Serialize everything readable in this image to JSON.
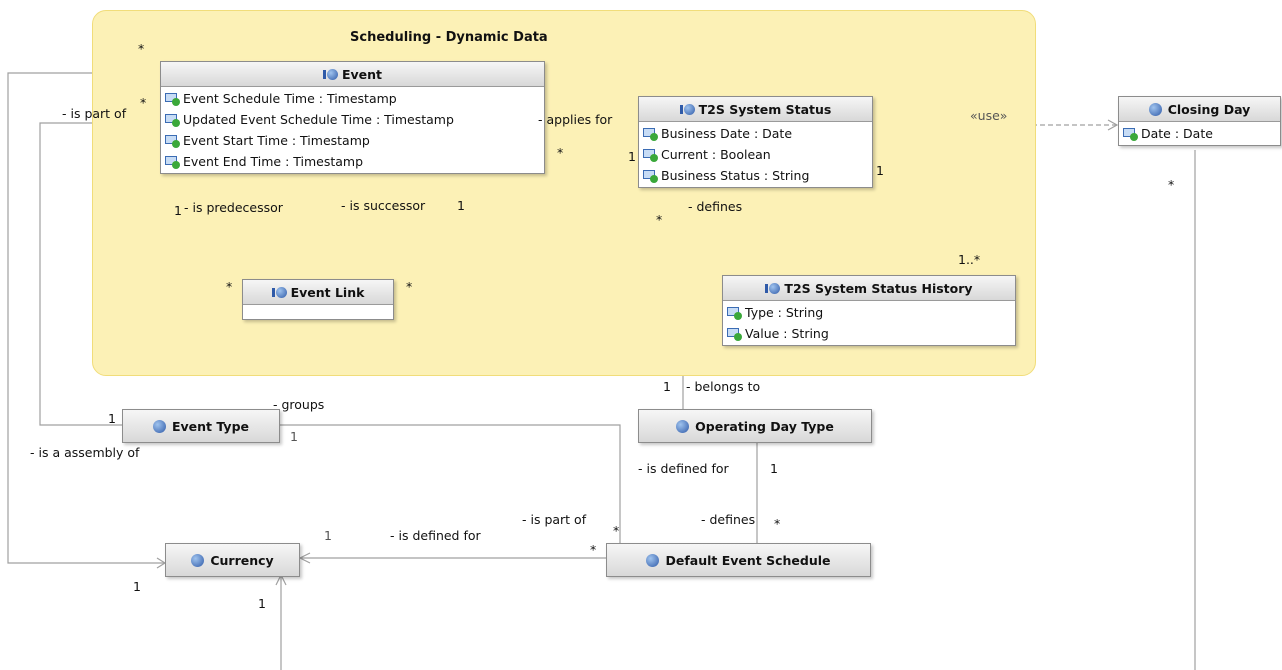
{
  "package": {
    "title": "Scheduling - Dynamic Data"
  },
  "classes": {
    "event": {
      "name": "Event",
      "attributes": [
        "Event Schedule Time : Timestamp",
        "Updated Event Schedule Time : Timestamp",
        "Event Start Time : Timestamp",
        "Event End Time : Timestamp"
      ]
    },
    "t2s_status": {
      "name": "T2S System Status",
      "attributes": [
        "Business Date : Date",
        "Current : Boolean",
        "Business Status : String"
      ]
    },
    "closing_day": {
      "name": "Closing Day",
      "attributes": [
        "Date : Date"
      ]
    },
    "event_link": {
      "name": "Event Link"
    },
    "t2s_history": {
      "name": "T2S System Status History",
      "attributes": [
        "Type : String",
        "Value : String"
      ]
    },
    "event_type": {
      "name": "Event Type"
    },
    "operating_day_type": {
      "name": "Operating Day Type"
    },
    "currency": {
      "name": "Currency"
    },
    "default_event_schedule": {
      "name": "Default Event Schedule"
    }
  },
  "labels": {
    "star_event_top": "*",
    "star_event_left": "*",
    "is_part_of_1": "- is part of",
    "applies_for": "- applies for",
    "star_applies": "*",
    "one_applies": "1",
    "use": "«use»",
    "one_status_right": "1",
    "one_pred": "1",
    "is_predecessor": "- is predecessor",
    "is_successor": "- is successor",
    "one_succ": "1",
    "defines_1": "- defines",
    "star_defines": "*",
    "star_link_left": "*",
    "star_link_right": "*",
    "one_many": "1..*",
    "star_closing": "*",
    "one_belongs": "1",
    "belongs_to": "- belongs to",
    "groups": "- groups",
    "one_event_type_left": "1",
    "one_event_type_right": "1",
    "is_assembly_of": "- is a assembly of",
    "is_defined_for_1": "- is defined for",
    "one_defined_for": "1",
    "one_currency_left": "1",
    "is_defined_for_2": "- is defined for",
    "is_part_of_2": "- is part of",
    "star_part_of": "*",
    "defines_2": "- defines",
    "star_defines_2": "*",
    "star_currency_edge": "*",
    "one_currency_below": "1",
    "one_currency_bottom": "1"
  }
}
